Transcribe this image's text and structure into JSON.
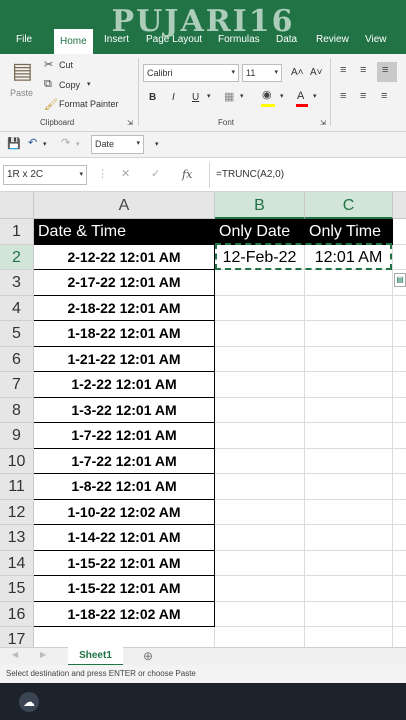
{
  "watermark": "PUJARI16",
  "ribbon_tabs": [
    "File",
    "Home",
    "Insert",
    "Page Layout",
    "Formulas",
    "Data",
    "Review",
    "View"
  ],
  "clipboard": {
    "paste": "Paste",
    "cut": "Cut",
    "copy": "Copy",
    "format_painter": "Format Painter",
    "group_label": "Clipboard"
  },
  "font": {
    "name": "Calibri",
    "size": "11",
    "bold": "B",
    "italic": "I",
    "underline": "U",
    "grow": "A˄",
    "shrink": "A˅",
    "color_a": "A",
    "group_label": "Font"
  },
  "qat": {
    "number_format": "Date"
  },
  "formula_bar": {
    "name_box": "1R x 2C",
    "fx": "fx",
    "formula": "=TRUNC(A2,0)"
  },
  "columns": [
    "A",
    "B",
    "C"
  ],
  "rows": [
    "1",
    "2",
    "3",
    "4",
    "5",
    "6",
    "7",
    "8",
    "9",
    "10",
    "11",
    "12",
    "13",
    "14",
    "15",
    "16",
    "17"
  ],
  "headers": {
    "a": "Date & Time",
    "b": "Only Date",
    "c": "Only Time"
  },
  "row2": {
    "b": "12-Feb-22",
    "c": "12:01 AM"
  },
  "dates": [
    "2-12-22 12:01 AM",
    "2-17-22 12:01 AM",
    "2-18-22 12:01 AM",
    "1-18-22 12:01 AM",
    "1-21-22 12:01 AM",
    "1-2-22 12:01 AM",
    "1-3-22 12:01 AM",
    "1-7-22 12:01 AM",
    "1-7-22 12:01 AM",
    "1-8-22 12:01 AM",
    "1-10-22 12:02 AM",
    "1-14-22 12:01 AM",
    "1-15-22 12:01 AM",
    "1-15-22 12:01 AM",
    "1-18-22 12:02 AM"
  ],
  "sheet_tab": "Sheet1",
  "status_text": "Select destination and press ENTER or choose Paste",
  "colors": {
    "accent": "#217346",
    "header_bg": "#000000"
  }
}
